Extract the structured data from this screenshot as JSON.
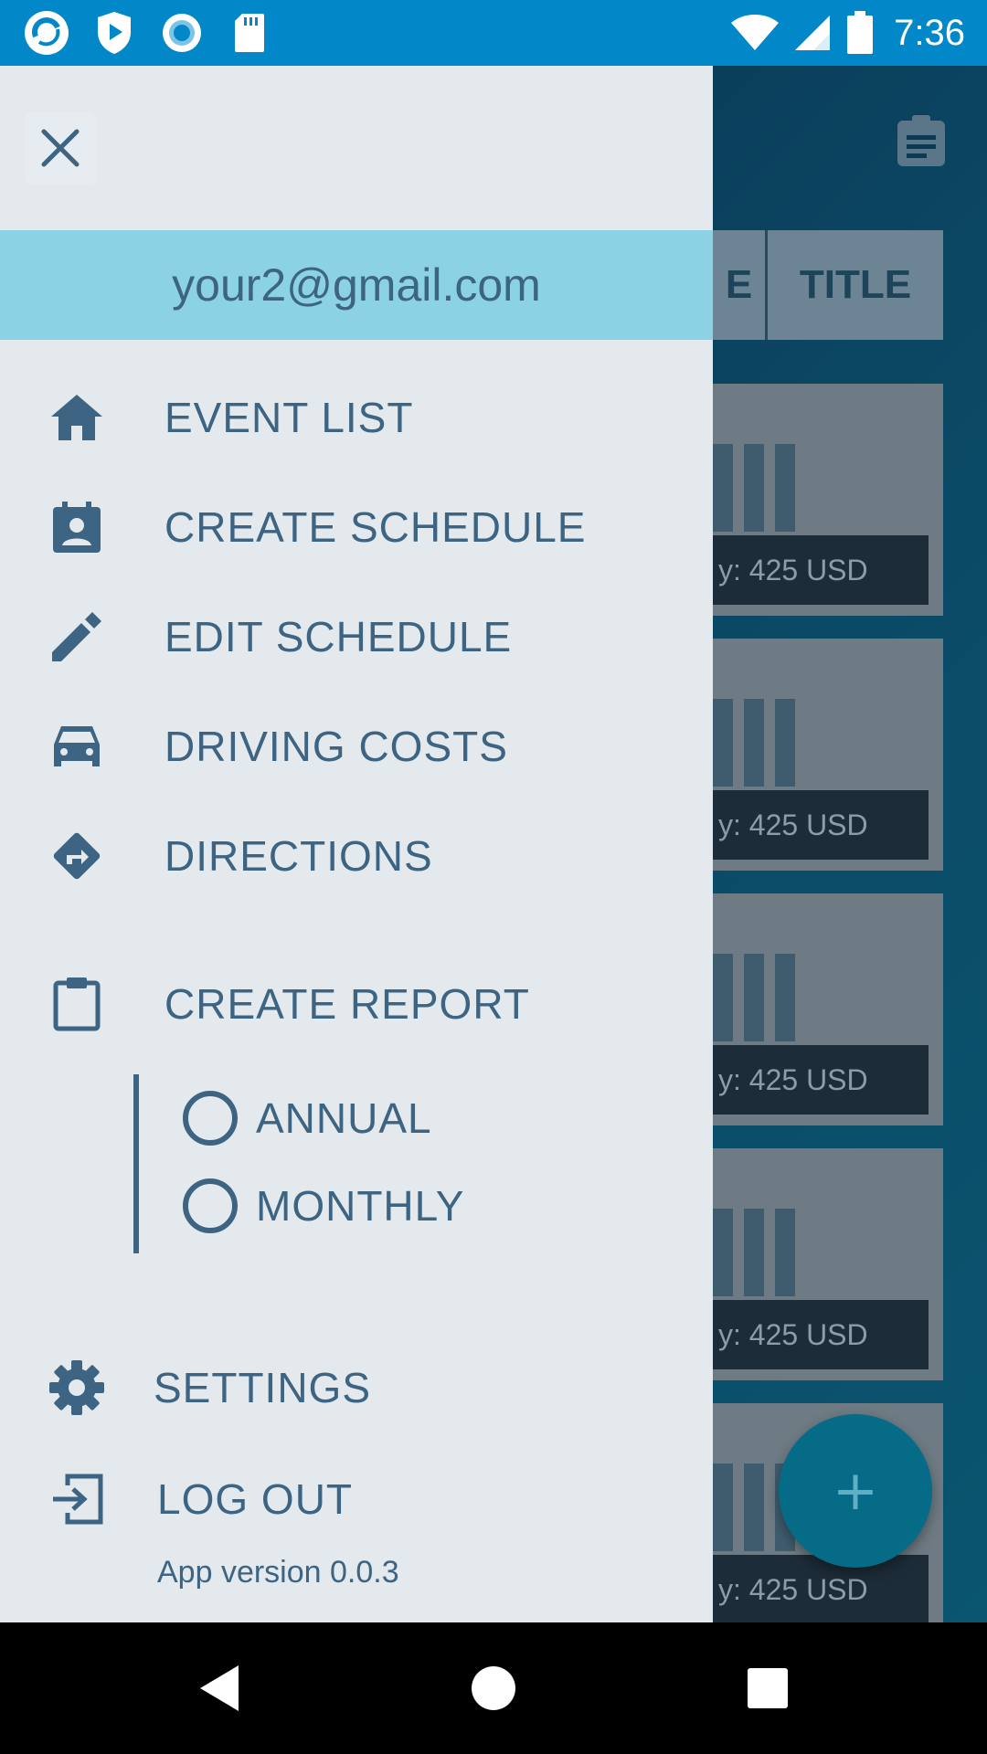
{
  "status_bar": {
    "time": "7:36",
    "left_icons": [
      "app-icon",
      "shield-play-icon",
      "record-icon",
      "sd-card-icon"
    ],
    "right_icons": [
      "wifi-icon",
      "cell-signal-icon",
      "battery-icon"
    ]
  },
  "background": {
    "header_cells": [
      "E",
      "TITLE"
    ],
    "card_amount": "y: 425 USD",
    "fab_label": "+"
  },
  "drawer": {
    "account_email": "your2@gmail.com",
    "items": [
      {
        "label": "EVENT LIST",
        "icon": "home-icon"
      },
      {
        "label": "CREATE SCHEDULE",
        "icon": "contact-calendar-icon"
      },
      {
        "label": "EDIT SCHEDULE",
        "icon": "pencil-icon"
      },
      {
        "label": "DRIVING COSTS",
        "icon": "car-icon"
      },
      {
        "label": "DIRECTIONS",
        "icon": "directions-icon"
      },
      {
        "label": "CREATE REPORT",
        "icon": "clipboard-icon"
      }
    ],
    "report_options": [
      {
        "label": "ANNUAL",
        "selected": false
      },
      {
        "label": "MONTHLY",
        "selected": false
      }
    ],
    "settings_label": "SETTINGS",
    "logout_label": "LOG OUT",
    "version_text": "App version  0.0.3"
  },
  "colors": {
    "status_bar": "#0288c8",
    "drawer_bg": "#e3e9ec",
    "account_bar": "#8ad2e4",
    "text": "#3d6482"
  }
}
